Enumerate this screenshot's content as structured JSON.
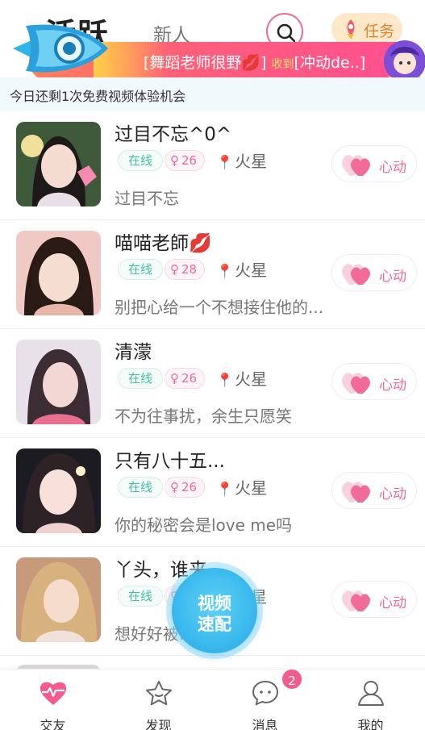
{
  "topnav": {
    "tab_active": "活跃",
    "tab_new": "新人",
    "task_label": "任务"
  },
  "banner": {
    "text_part1": "[舞蹈老师很野",
    "text_got": "收到",
    "text_part2": "[冲动de..]"
  },
  "notice": {
    "text": "今日还剩1次免费视频体验机会"
  },
  "colors": {
    "accent": "#f06b98",
    "online": "#46bfa8",
    "video": "#3bb9ee",
    "notice_bg": "#f2f9fd"
  },
  "users": [
    {
      "name": "过目不忘^0^",
      "status": "在线",
      "age": "26",
      "location": "火星",
      "signature": "过目不忘",
      "like": "心动"
    },
    {
      "name": "喵喵老師💋",
      "status": "在线",
      "age": "28",
      "location": "火星",
      "signature": "别把心给一个不想接住他的...",
      "like": "心动"
    },
    {
      "name": "清濛",
      "status": "在线",
      "age": "26",
      "location": "火星",
      "signature": "不为往事扰，余生只愿笑",
      "like": "心动"
    },
    {
      "name": "只有八十五...",
      "status": "在线",
      "age": "26",
      "location": "火星",
      "signature": "你的秘密会是love me吗",
      "like": "心动"
    },
    {
      "name": "丫头，谁来...",
      "status": "在线",
      "age": "26",
      "location": "火星",
      "signature": "想好好被...",
      "like": "心动"
    }
  ],
  "video_match": {
    "line1": "视频",
    "line2": "速配"
  },
  "tabbar": {
    "items": [
      {
        "label": "交友",
        "icon": "heartbeat-icon"
      },
      {
        "label": "发现",
        "icon": "star-icon"
      },
      {
        "label": "消息",
        "icon": "chat-icon"
      },
      {
        "label": "我的",
        "icon": "user-icon"
      }
    ],
    "message_badge": "2"
  }
}
